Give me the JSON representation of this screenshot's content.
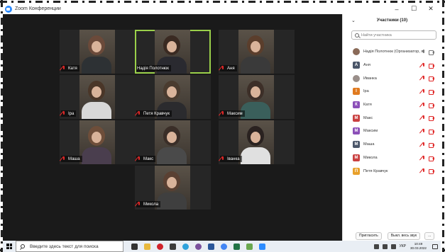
{
  "window": {
    "app_title": "Zoom Конференции",
    "controls": [
      "–",
      "☐",
      "✕"
    ]
  },
  "video_tiles": [
    {
      "name": "Катя",
      "muted": true,
      "active": false,
      "head": "#6b4a3a",
      "body": "#2d3134"
    },
    {
      "name": "Надія Полотнюк",
      "muted": false,
      "active": true,
      "head": "#3a2a22",
      "body": "#2a2a30"
    },
    {
      "name": "Аня",
      "muted": true,
      "active": false,
      "head": "#5b3e2c",
      "body": "#3a3a3a"
    },
    {
      "name": "Іра",
      "muted": true,
      "active": false,
      "head": "#4a3628",
      "body": "#d8d8d8"
    },
    {
      "name": "Петя Кравчук",
      "muted": true,
      "active": false,
      "head": "#4a3b2f",
      "body": "#2b2b2e"
    },
    {
      "name": "Максим",
      "muted": true,
      "active": false,
      "head": "#3d2f28",
      "body": "#3a5f5b"
    },
    {
      "name": "Маша",
      "muted": true,
      "active": false,
      "head": "#6e4e3a",
      "body": "#4a3e4e"
    },
    {
      "name": "Макс",
      "muted": true,
      "active": false,
      "head": "#3a2e28",
      "body": "#4a4a4a"
    },
    {
      "name": "Іванка",
      "muted": true,
      "active": false,
      "head": "#2a2220",
      "body": "#e0e0e0"
    },
    {
      "name": "Микола",
      "muted": true,
      "active": false,
      "head": "#5a4032",
      "body": "#3f3f3f"
    }
  ],
  "participants_panel": {
    "title": "Участники (10)",
    "search_placeholder": "Найти участника",
    "participants": [
      {
        "name": "Надія Полотнюк (Организатор, я)",
        "initial": "",
        "color": "#8a6a58",
        "host": true
      },
      {
        "name": "Аня",
        "initial": "А",
        "color": "#4a5568",
        "host": false
      },
      {
        "name": "Иванка",
        "initial": "",
        "color": "#9a8f8a",
        "host": false
      },
      {
        "name": "Іра",
        "initial": "І",
        "color": "#e07a1f",
        "host": false
      },
      {
        "name": "Катя",
        "initial": "К",
        "color": "#8b4fb8",
        "host": false
      },
      {
        "name": "Макс",
        "initial": "М",
        "color": "#c94040",
        "host": false
      },
      {
        "name": "Максим",
        "initial": "М",
        "color": "#8b4fb8",
        "host": false
      },
      {
        "name": "Маша",
        "initial": "М",
        "color": "#4a5568",
        "host": false
      },
      {
        "name": "Микола",
        "initial": "М",
        "color": "#c94040",
        "host": false
      },
      {
        "name": "Петя Кравчук",
        "initial": "П",
        "color": "#e8a02a",
        "host": false
      }
    ],
    "invite_label": "Пригласить",
    "mute_all_label": "Выкл. весь звук",
    "more_label": "..."
  },
  "taskbar": {
    "search_text": "Введите здесь текст для поиска",
    "apps": [
      {
        "name": "task-view-icon",
        "color": "#333333"
      },
      {
        "name": "file-explorer-icon",
        "color": "#e9b93d"
      },
      {
        "name": "opera-icon",
        "color": "#d0222b"
      },
      {
        "name": "yandex-icon",
        "color": "#3b3b3b"
      },
      {
        "name": "telegram-icon",
        "color": "#2ea2dc"
      },
      {
        "name": "viber-icon",
        "color": "#7b519d"
      },
      {
        "name": "word-icon",
        "color": "#2b579a"
      },
      {
        "name": "chrome-icon",
        "color": "#4285f4"
      },
      {
        "name": "excel-icon",
        "color": "#217346"
      },
      {
        "name": "app-icon",
        "color": "#6aa84f"
      },
      {
        "name": "zoom-icon",
        "color": "#2d8cff"
      }
    ],
    "language": "УКР",
    "time": "10:49",
    "date": "30.03.2022"
  }
}
